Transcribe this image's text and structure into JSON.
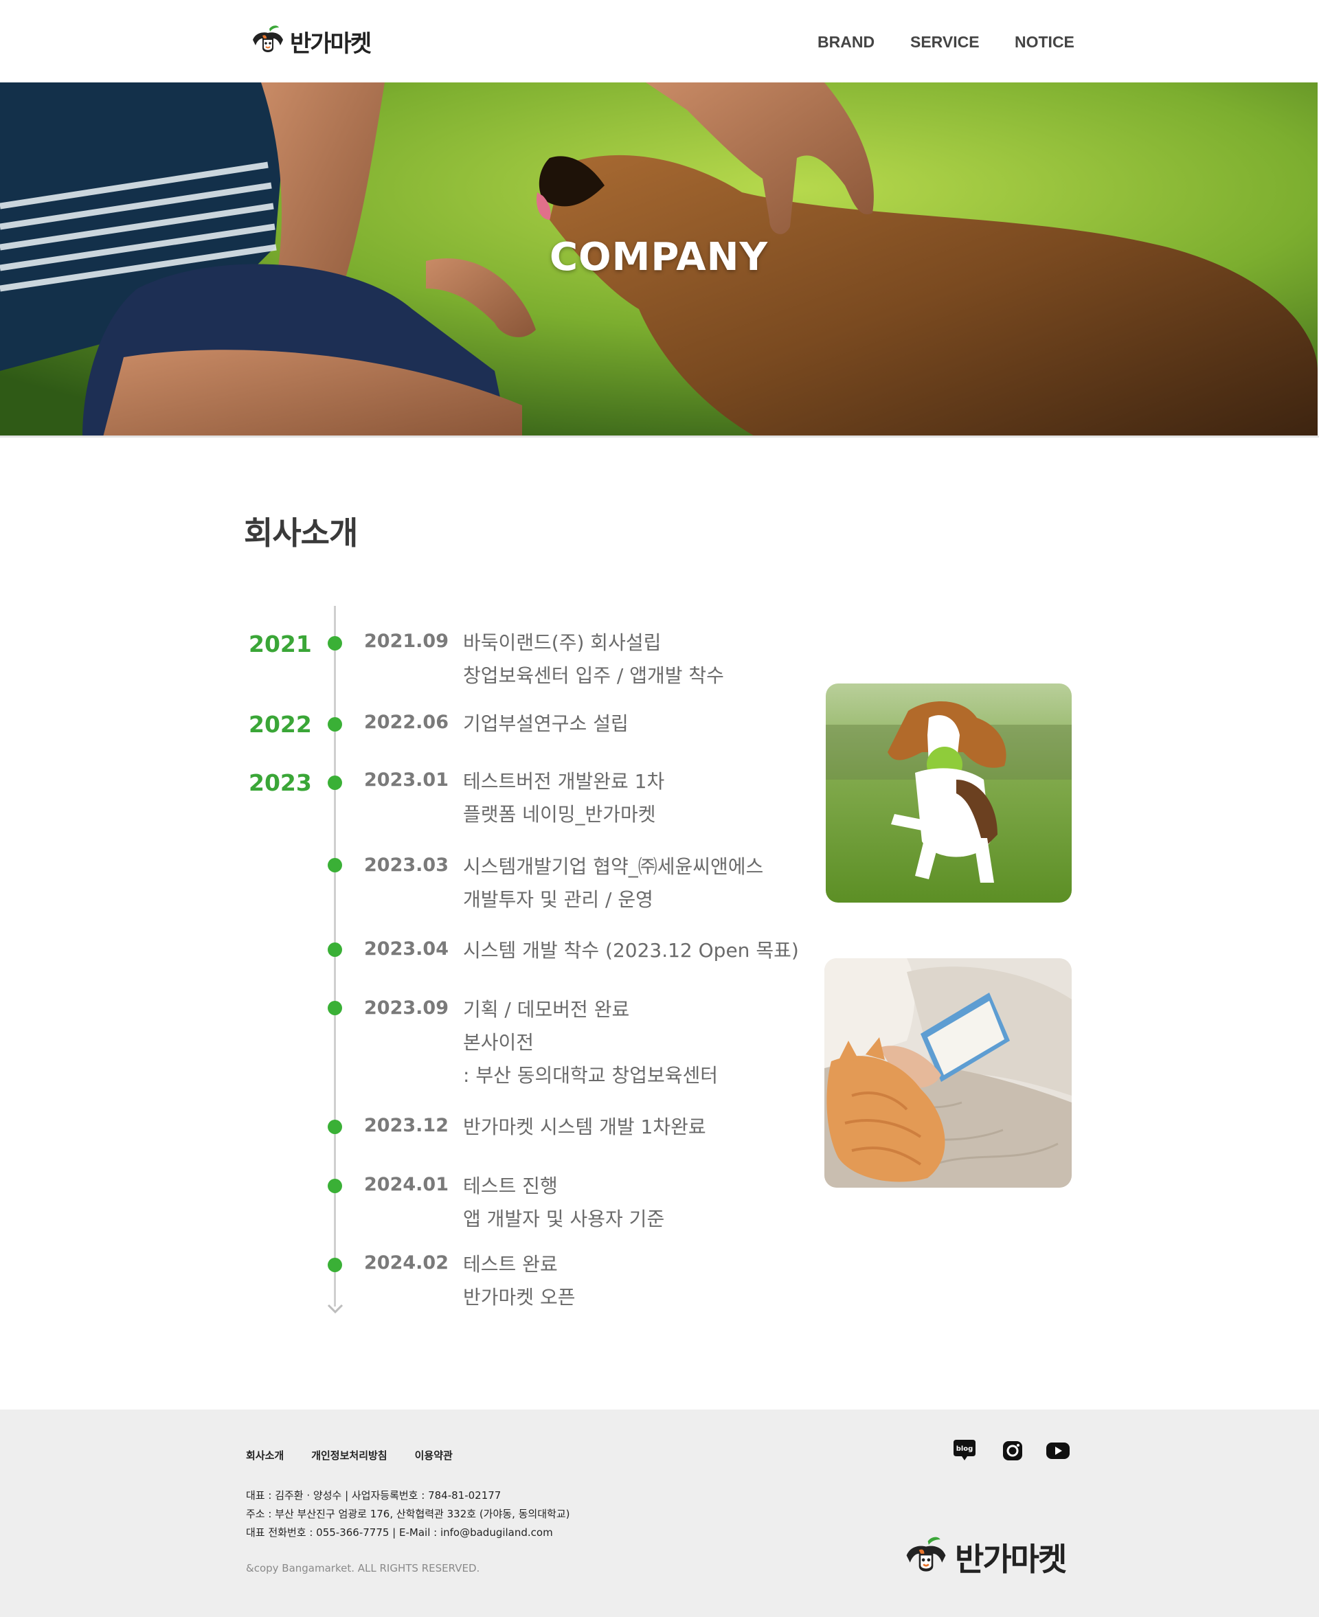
{
  "header": {
    "logo_text": "반가마켓",
    "nav": [
      {
        "label": "BRAND"
      },
      {
        "label": "SERVICE"
      },
      {
        "label": "NOTICE"
      }
    ]
  },
  "hero": {
    "title": "COMPANY"
  },
  "section": {
    "title": "회사소개",
    "years": [
      "2021",
      "2022",
      "2023"
    ],
    "timeline": [
      {
        "date": "2021.09",
        "lines": [
          "바둑이랜드(주) 회사설립",
          "창업보육센터 입주 / 앱개발 착수"
        ]
      },
      {
        "date": "2022.06",
        "lines": [
          "기업부설연구소 설립"
        ]
      },
      {
        "date": "2023.01",
        "lines": [
          "테스트버전 개발완료 1차",
          "플랫폼 네이밍_반가마켓"
        ]
      },
      {
        "date": "2023.03",
        "lines": [
          "시스템개발기업 협약_㈜세윤씨앤에스",
          "개발투자 및 관리 / 운영"
        ]
      },
      {
        "date": "2023.04",
        "lines": [
          "시스템 개발 착수 (2023.12 Open 목표)"
        ]
      },
      {
        "date": "2023.09",
        "lines": [
          "기획 / 데모버전 완료",
          "본사이전",
          ": 부산 동의대학교 창업보육센터"
        ]
      },
      {
        "date": "2023.12",
        "lines": [
          "반가마켓 시스템 개발 1차완료"
        ]
      },
      {
        "date": "2024.01",
        "lines": [
          "테스트 진행",
          "앱 개발자 및 사용자 기준"
        ]
      },
      {
        "date": "2024.02",
        "lines": [
          "테스트 완료",
          "반가마켓 오픈"
        ]
      }
    ]
  },
  "footer": {
    "links": [
      "회사소개",
      "개인정보처리방침",
      "이용약관"
    ],
    "info": [
      "대표 : 김주환 · 양성수 | 사업자등록번호 : 784-81-02177",
      "주소 : 부산 부산진구 엄광로 176, 산학협력관 332호 (가야동, 동의대학교)",
      "대표 전화번호 : 055-366-7775 | E-Mail : info@badugiland.com"
    ],
    "copyright": "&copy Bangamarket. ALL RIGHTS RESERVED.",
    "social": [
      "blog-icon",
      "instagram-icon",
      "youtube-icon"
    ],
    "logo_text": "반가마켓",
    "blog_badge": "blog"
  },
  "colors": {
    "accent": "#3aa637",
    "dot": "#3ab036",
    "footer_bg": "#eeeeee"
  }
}
